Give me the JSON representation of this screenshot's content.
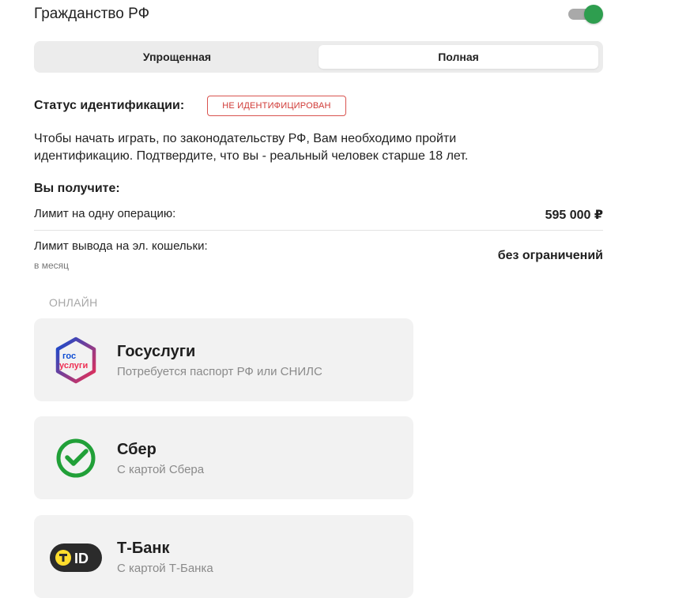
{
  "citizenship": {
    "title": "Гражданство РФ",
    "toggle_on": true,
    "toggle_color": "#2e9e4f"
  },
  "tabs": [
    {
      "label": "Упрощенная",
      "active": false
    },
    {
      "label": "Полная",
      "active": true
    }
  ],
  "status": {
    "label": "Статус идентификации:",
    "badge": "НЕ ИДЕНТИФИЦИРОВАН",
    "badge_color": "#d03a36"
  },
  "description": "Чтобы начать играть, по законодательству РФ, Вам необходимо пройти идентификацию. Подтвердите, что вы - реальный человек старше 18 лет.",
  "benefits": {
    "title": "Вы получите:",
    "limits": [
      {
        "label": "Лимит на одну операцию:",
        "value": "595 000 ₽"
      },
      {
        "label": "Лимит вывода на эл. кошельки:",
        "sublabel": "в месяц",
        "value": "без ограничений"
      }
    ]
  },
  "online_section": {
    "label": "ОНЛАЙН"
  },
  "providers": [
    {
      "name": "Госуслуги",
      "description": "Потребуется паспорт РФ или СНИЛС",
      "icon": "gosuslugi-logo",
      "logo_text_top": "гос",
      "logo_text_bottom": "услуги"
    },
    {
      "name": "Сбер",
      "description": "С картой Сбера",
      "icon": "sber-logo",
      "accent": "#21a038"
    },
    {
      "name": "Т-Банк",
      "description": "С картой Т-Банка",
      "icon": "tbank-id-logo",
      "logo_text": "ID",
      "accent": "#ffdd2d"
    }
  ]
}
